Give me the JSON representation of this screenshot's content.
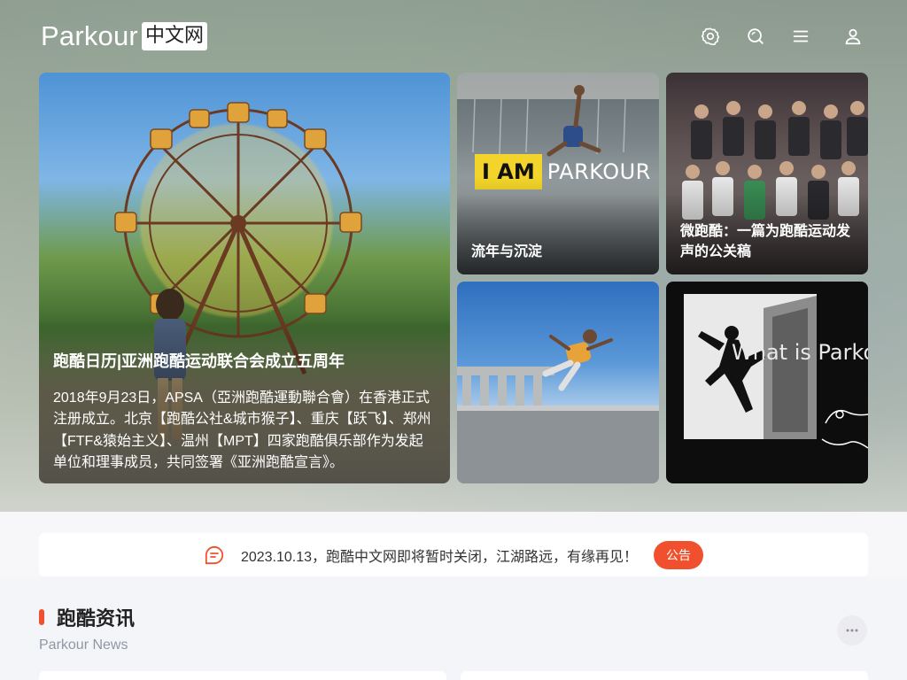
{
  "header": {
    "logo_word": "Parkour",
    "logo_cn": "中文网"
  },
  "icons": {
    "settings": "gear-icon",
    "search": "search-icon",
    "menu": "menu-icon",
    "user": "user-icon"
  },
  "featured": {
    "main": {
      "title": "跑酷日历|亚洲跑酷运动联合会成立五周年",
      "description": "2018年9月23日，APSA（亞洲跑酷運動聯合會）在香港正式注册成立。北京【跑酷公社&城市猴子】、重庆【跃飞】、郑州【FTF&猿始主义】、温州【MPT】四家跑酷俱乐部作为发起单位和理事成员，共同签署《亚洲跑酷宣言》。"
    },
    "card_a": {
      "title": "流年与沉淀",
      "badge_highlight": "I AM",
      "badge_rest": "PARKOUR"
    },
    "card_b": {
      "title": "微跑酷：一篇为跑酷运动发声的公关稿"
    },
    "card_c": {
      "title": ""
    },
    "card_d": {
      "title": "",
      "image_text": "What is Parko"
    }
  },
  "notice": {
    "text": "2023.10.13，跑酷中文网即将暂时关闭，江湖路远，有缘再见！",
    "badge": "公告"
  },
  "section": {
    "title": "跑酷资讯",
    "subtitle": "Parkour News"
  },
  "colors": {
    "accent": "#f0502e",
    "badge_yellow": "#f2d42a"
  }
}
